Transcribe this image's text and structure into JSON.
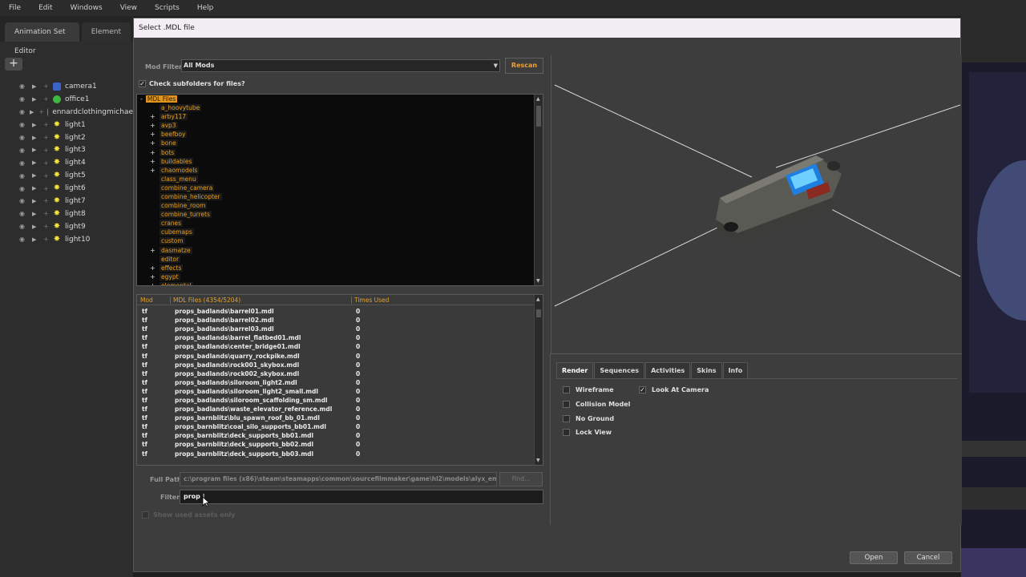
{
  "menubar": [
    "File",
    "Edit",
    "Windows",
    "View",
    "Scripts",
    "Help"
  ],
  "left_panel": {
    "tabs": [
      "Animation Set Editor",
      "Element"
    ],
    "add_label": "+",
    "items": [
      {
        "name": "camera1",
        "icon": "camera-icon"
      },
      {
        "name": "office1",
        "icon": "model-icon"
      },
      {
        "name": "ennardclothingmichae",
        "icon": "model-icon"
      },
      {
        "name": "light1",
        "icon": "light-icon"
      },
      {
        "name": "light2",
        "icon": "light-icon"
      },
      {
        "name": "light3",
        "icon": "light-icon"
      },
      {
        "name": "light4",
        "icon": "light-icon"
      },
      {
        "name": "light5",
        "icon": "light-icon"
      },
      {
        "name": "light6",
        "icon": "light-icon"
      },
      {
        "name": "light7",
        "icon": "light-icon"
      },
      {
        "name": "light8",
        "icon": "light-icon"
      },
      {
        "name": "light9",
        "icon": "light-icon"
      },
      {
        "name": "light10",
        "icon": "light-icon"
      }
    ]
  },
  "dialog": {
    "title": "Select .MDL file",
    "mod_filter_label": "Mod Filter",
    "mod_filter_value": "All Mods",
    "rescan_label": "Rescan",
    "check_subfolders_label": "Check subfolders for files?",
    "tree": {
      "root": "MDL Files",
      "folders": [
        {
          "name": "a_hoovytube",
          "expandable": false
        },
        {
          "name": "arby117",
          "expandable": true
        },
        {
          "name": "avp3",
          "expandable": true
        },
        {
          "name": "beefboy",
          "expandable": true
        },
        {
          "name": "bone",
          "expandable": true
        },
        {
          "name": "bots",
          "expandable": true
        },
        {
          "name": "buildables",
          "expandable": true
        },
        {
          "name": "chaomodels",
          "expandable": true
        },
        {
          "name": "class_menu",
          "expandable": false
        },
        {
          "name": "combine_camera",
          "expandable": false
        },
        {
          "name": "combine_helicopter",
          "expandable": false
        },
        {
          "name": "combine_room",
          "expandable": false
        },
        {
          "name": "combine_turrets",
          "expandable": false
        },
        {
          "name": "cranes",
          "expandable": false
        },
        {
          "name": "cubemaps",
          "expandable": false
        },
        {
          "name": "custom",
          "expandable": false
        },
        {
          "name": "dasmatze",
          "expandable": true
        },
        {
          "name": "editor",
          "expandable": false
        },
        {
          "name": "effects",
          "expandable": true
        },
        {
          "name": "egypt",
          "expandable": true
        },
        {
          "name": "elemental",
          "expandable": true
        }
      ]
    },
    "files": {
      "headers": [
        "Mod",
        "MDL Files (4354/5204)",
        "Times Used"
      ],
      "rows": [
        [
          "tf",
          "props_badlands\\barrel01.mdl",
          "0"
        ],
        [
          "tf",
          "props_badlands\\barrel02.mdl",
          "0"
        ],
        [
          "tf",
          "props_badlands\\barrel03.mdl",
          "0"
        ],
        [
          "tf",
          "props_badlands\\barrel_flatbed01.mdl",
          "0"
        ],
        [
          "tf",
          "props_badlands\\center_bridge01.mdl",
          "0"
        ],
        [
          "tf",
          "props_badlands\\quarry_rockpike.mdl",
          "0"
        ],
        [
          "tf",
          "props_badlands\\rock001_skybox.mdl",
          "0"
        ],
        [
          "tf",
          "props_badlands\\rock002_skybox.mdl",
          "0"
        ],
        [
          "tf",
          "props_badlands\\siloroom_light2.mdl",
          "0"
        ],
        [
          "tf",
          "props_badlands\\siloroom_light2_small.mdl",
          "0"
        ],
        [
          "tf",
          "props_badlands\\siloroom_scaffolding_sm.mdl",
          "0"
        ],
        [
          "tf",
          "props_badlands\\waste_elevator_reference.mdl",
          "0"
        ],
        [
          "tf",
          "props_barnblitz\\blu_spawn_roof_bb_01.mdl",
          "0"
        ],
        [
          "tf",
          "props_barnblitz\\coal_silo_supports_bb01.mdl",
          "0"
        ],
        [
          "tf",
          "props_barnblitz\\deck_supports_bb01.mdl",
          "0"
        ],
        [
          "tf",
          "props_barnblitz\\deck_supports_bb02.mdl",
          "0"
        ],
        [
          "tf",
          "props_barnblitz\\deck_supports_bb03.mdl",
          "0"
        ]
      ]
    },
    "full_path_label": "Full Path",
    "full_path_value": "c:\\program files (x86)\\steam\\steamapps\\common\\sourcefilmmaker\\game\\hl2\\models\\alyx_em",
    "find_label": "Find...",
    "filter_label": "Filter",
    "filter_value": "prop |",
    "show_used_label": "Show used assets only",
    "preview_tabs": [
      "Render",
      "Sequences",
      "Activities",
      "Skins",
      "Info"
    ],
    "render_options": [
      {
        "label": "Wireframe",
        "checked": false
      },
      {
        "label": "Collision Model",
        "checked": false
      },
      {
        "label": "No Ground",
        "checked": false
      },
      {
        "label": "Lock View",
        "checked": false
      },
      {
        "label": "Look At Camera",
        "checked": true
      }
    ],
    "open_label": "Open",
    "cancel_label": "Cancel"
  },
  "colors": {
    "accent": "#e8a020",
    "background": "#3d3d3d",
    "tree_bg": "#0b0b0b"
  }
}
